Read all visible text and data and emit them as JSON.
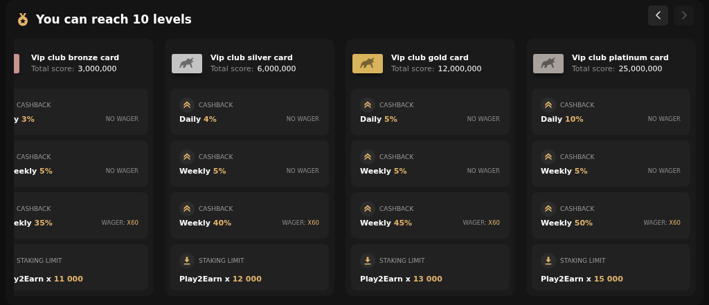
{
  "header": {
    "title": "You can reach 10 levels",
    "nav": [
      {
        "kind": "prev",
        "disabled": false
      },
      {
        "kind": "next",
        "disabled": true
      }
    ]
  },
  "cards": [
    {
      "kind": "clipped",
      "color": "#c8928f",
      "name": "Vip club bronze card",
      "score_label": "Total score:",
      "score": "3,000,000",
      "rows": [
        {
          "kind": "cashback",
          "label": "CASHBACK",
          "text": "y",
          "highlight": "3%",
          "wager_label": "NO WAGER"
        },
        {
          "kind": "cashback",
          "label": "CASHBACK",
          "text": "eekly",
          "highlight": "5%",
          "wager_label": "NO WAGER"
        },
        {
          "kind": "cashback",
          "label": "CASHBACK",
          "text": "ekly",
          "highlight": "35%",
          "wager_label": "WAGER:",
          "wager_value": "X60"
        },
        {
          "kind": "staking",
          "label": "STAKING LIMIT",
          "text": "y2Earn x",
          "highlight": "11 000"
        }
      ]
    },
    {
      "kind": "full",
      "color": "#c4c4c4",
      "name": "Vip club silver card",
      "score_label": "Total score:",
      "score": "6,000,000",
      "rows": [
        {
          "kind": "cashback",
          "label": "CASHBACK",
          "text": "Daily",
          "highlight": "4%",
          "wager_label": "NO WAGER"
        },
        {
          "kind": "cashback",
          "label": "CASHBACK",
          "text": "Weekly",
          "highlight": "5%",
          "wager_label": "NO WAGER"
        },
        {
          "kind": "cashback",
          "label": "CASHBACK",
          "text": "Weekly",
          "highlight": "40%",
          "wager_label": "WAGER:",
          "wager_value": "X60"
        },
        {
          "kind": "staking",
          "label": "STAKING LIMIT",
          "text": "Play2Earn x",
          "highlight": "12 000"
        }
      ]
    },
    {
      "kind": "full",
      "color": "#d9b45c",
      "name": "Vip club gold card",
      "score_label": "Total score:",
      "score": "12,000,000",
      "rows": [
        {
          "kind": "cashback",
          "label": "CASHBACK",
          "text": "Daily",
          "highlight": "5%",
          "wager_label": "NO WAGER"
        },
        {
          "kind": "cashback",
          "label": "CASHBACK",
          "text": "Weekly",
          "highlight": "5%",
          "wager_label": "NO WAGER"
        },
        {
          "kind": "cashback",
          "label": "CASHBACK",
          "text": "Weekly",
          "highlight": "45%",
          "wager_label": "WAGER:",
          "wager_value": "X60"
        },
        {
          "kind": "staking",
          "label": "STAKING LIMIT",
          "text": "Play2Earn x",
          "highlight": "13 000"
        }
      ]
    },
    {
      "kind": "full",
      "color": "#a9a19b",
      "name": "Vip club platinum card",
      "score_label": "Total score:",
      "score": "25,000,000",
      "rows": [
        {
          "kind": "cashback",
          "label": "CASHBACK",
          "text": "Daily",
          "highlight": "10%",
          "wager_label": "NO WAGER"
        },
        {
          "kind": "cashback",
          "label": "CASHBACK",
          "text": "Weekly",
          "highlight": "5%",
          "wager_label": "NO WAGER"
        },
        {
          "kind": "cashback",
          "label": "CASHBACK",
          "text": "Weekly",
          "highlight": "50%",
          "wager_label": "WAGER:",
          "wager_value": "X60"
        },
        {
          "kind": "staking",
          "label": "STAKING LIMIT",
          "text": "Play2Earn x",
          "highlight": "15 000"
        }
      ]
    }
  ]
}
